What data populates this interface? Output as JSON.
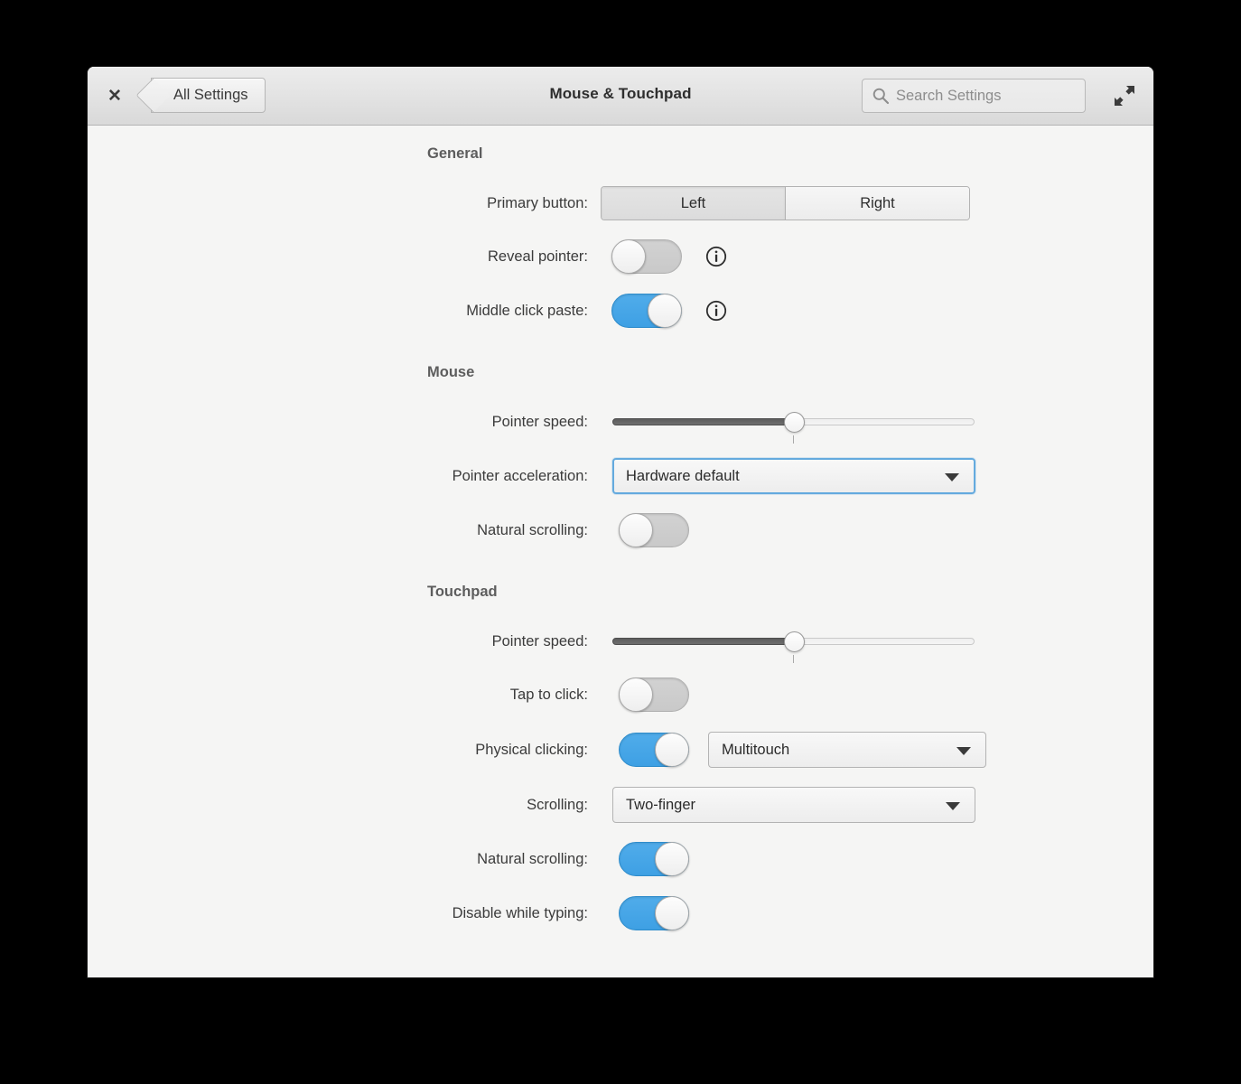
{
  "window": {
    "title": "Mouse & Touchpad",
    "close_label": "✕",
    "back_label": "All Settings",
    "search_placeholder": "Search Settings",
    "icons": {
      "close": "close-icon",
      "back": "back-chevron-icon",
      "search": "search-icon",
      "maximize": "maximize-icon"
    }
  },
  "colors": {
    "accent_blue": "#3ea0e4",
    "focus_border": "#64aade",
    "header_bg": "#e4e4e4",
    "content_bg": "#f5f5f4",
    "label_text": "#3b3b3b",
    "section_text": "#5d5d5d"
  },
  "sections": {
    "general": {
      "title": "General",
      "primary_button": {
        "label": "Primary button:",
        "options": [
          "Left",
          "Right"
        ],
        "selected": "Left"
      },
      "reveal_pointer": {
        "label": "Reveal pointer:",
        "state": "off",
        "info": "ⓘ"
      },
      "middle_click_paste": {
        "label": "Middle click paste:",
        "state": "on",
        "info": "ⓘ"
      }
    },
    "mouse": {
      "title": "Mouse",
      "pointer_speed": {
        "label": "Pointer speed:",
        "value": 50,
        "min": 0,
        "max": 100
      },
      "pointer_acceleration": {
        "label": "Pointer acceleration:",
        "value": "Hardware default",
        "focused": true
      },
      "natural_scrolling": {
        "label": "Natural scrolling:",
        "state": "off"
      }
    },
    "touchpad": {
      "title": "Touchpad",
      "pointer_speed": {
        "label": "Pointer speed:",
        "value": 50,
        "min": 0,
        "max": 100
      },
      "tap_to_click": {
        "label": "Tap to click:",
        "state": "off"
      },
      "physical_clicking": {
        "label": "Physical clicking:",
        "state": "on",
        "value": "Multitouch"
      },
      "scrolling": {
        "label": "Scrolling:",
        "value": "Two-finger"
      },
      "natural_scrolling": {
        "label": "Natural scrolling:",
        "state": "on"
      },
      "disable_while_typing": {
        "label": "Disable while typing:",
        "state": "on"
      }
    }
  }
}
